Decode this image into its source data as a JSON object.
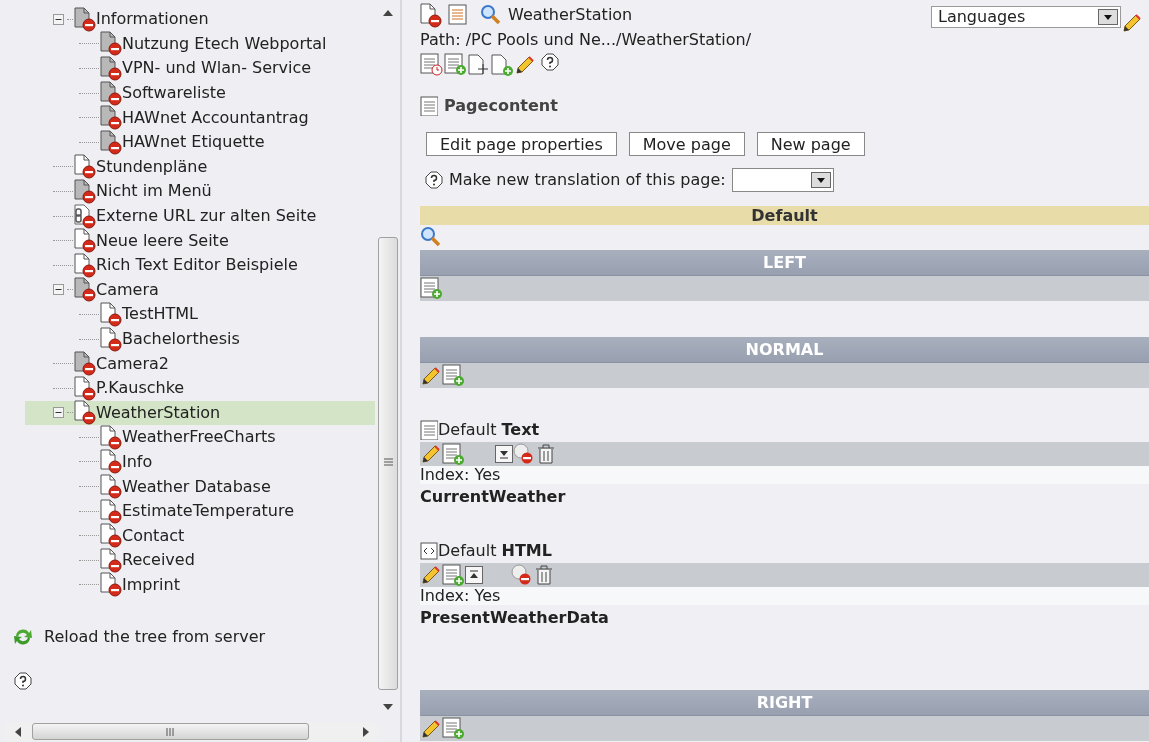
{
  "tree": [
    {
      "label": "Informationen",
      "kind": "hidden",
      "expanded": true,
      "selected": false,
      "children": [
        {
          "label": "Nutzung Etech Webportal",
          "kind": "hidden",
          "selected": false
        },
        {
          "label": "VPN- und Wlan- Service",
          "kind": "hidden",
          "selected": false
        },
        {
          "label": "Softwareliste",
          "kind": "hidden",
          "selected": false
        },
        {
          "label": "HAWnet Accountantrag",
          "kind": "hidden",
          "selected": false
        },
        {
          "label": "HAWnet Etiquette",
          "kind": "hidden",
          "selected": false
        }
      ]
    },
    {
      "label": "Stundenpläne",
      "kind": "page",
      "selected": false
    },
    {
      "label": "Nicht im Menü",
      "kind": "hidden",
      "selected": false
    },
    {
      "label": "Externe URL zur alten Seite",
      "kind": "link",
      "selected": false
    },
    {
      "label": "Neue leere Seite",
      "kind": "page",
      "selected": false
    },
    {
      "label": "Rich Text Editor Beispiele",
      "kind": "page",
      "selected": false
    },
    {
      "label": "Camera",
      "kind": "hidden",
      "expanded": true,
      "selected": false,
      "children": [
        {
          "label": "TestHTML",
          "kind": "page",
          "selected": false
        },
        {
          "label": "Bachelorthesis",
          "kind": "page",
          "selected": false
        }
      ]
    },
    {
      "label": "Camera2",
      "kind": "hidden",
      "selected": false
    },
    {
      "label": "P.Kauschke",
      "kind": "page",
      "selected": false
    },
    {
      "label": "WeatherStation",
      "kind": "page",
      "expanded": true,
      "selected": true,
      "children": [
        {
          "label": "WeatherFreeCharts",
          "kind": "page",
          "selected": false
        },
        {
          "label": "Info",
          "kind": "page",
          "selected": false
        },
        {
          "label": "Weather Database",
          "kind": "page",
          "selected": false
        },
        {
          "label": "EstimateTemperature",
          "kind": "page",
          "selected": false
        },
        {
          "label": "Contact",
          "kind": "page",
          "selected": false
        },
        {
          "label": "Received",
          "kind": "page",
          "selected": false
        },
        {
          "label": "Imprint",
          "kind": "page",
          "selected": false
        }
      ]
    }
  ],
  "tree_footer": {
    "reload": "Reload the tree from server"
  },
  "page_header": {
    "title": "WeatherStation",
    "path": "Path: /PC Pools und Ne.../WeatherStation/",
    "languages": "Languages"
  },
  "section_title": "Pagecontent",
  "buttons": [
    "Edit page properties",
    "Move page",
    "New page"
  ],
  "translation": {
    "label": "Make new translation of this page:"
  },
  "language_header": "Default",
  "columns": [
    {
      "title": "LEFT",
      "editable": false
    },
    {
      "title": "NORMAL",
      "editable": true,
      "elements": [
        {
          "kind": "text",
          "heading": "Default **Text**",
          "index": "Index: Yes",
          "title": "CurrentWeather"
        },
        {
          "kind": "html",
          "heading": "Default **HTML**",
          "index": "Index: Yes",
          "title": "PresentWeatherData"
        }
      ]
    },
    {
      "title": "RIGHT",
      "editable": true
    }
  ]
}
